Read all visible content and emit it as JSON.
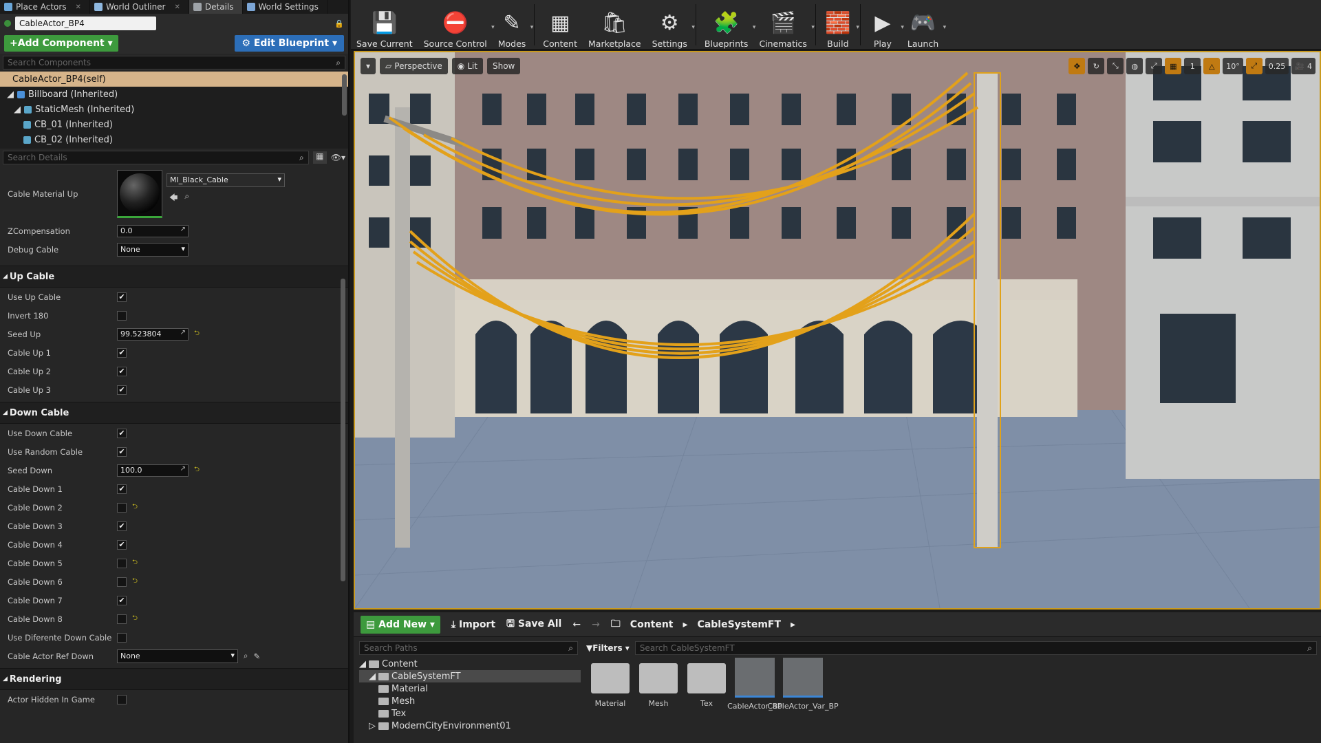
{
  "tabs": [
    {
      "label": "Place Actors",
      "icon": "place-actors-icon"
    },
    {
      "label": "World Outliner",
      "icon": "outliner-icon"
    },
    {
      "label": "Details",
      "icon": "details-icon"
    },
    {
      "label": "World Settings",
      "icon": "world-settings-icon"
    }
  ],
  "actor_name": "CableActor_BP4",
  "add_component_label": "Add Component",
  "edit_blueprint_label": "Edit Blueprint",
  "search_components_placeholder": "Search Components",
  "components": {
    "self": "CableActor_BP4(self)",
    "items": [
      {
        "label": "Billboard (Inherited)"
      },
      {
        "label": "StaticMesh (Inherited)"
      },
      {
        "label": "CB_01 (Inherited)"
      },
      {
        "label": "CB_02 (Inherited)"
      }
    ]
  },
  "search_details_placeholder": "Search Details",
  "props_top": {
    "material_label": "Cable Material Up",
    "material_value": "MI_Black_Cable",
    "zcomp_label": "ZCompensation",
    "zcomp_value": "0.0",
    "debug_label": "Debug Cable",
    "debug_value": "None"
  },
  "up_cable": {
    "title": "Up Cable",
    "rows": [
      {
        "label": "Use Up Cable",
        "type": "check",
        "checked": true
      },
      {
        "label": "Invert 180",
        "type": "check",
        "checked": false
      },
      {
        "label": "Seed Up",
        "type": "num",
        "value": "99.523804"
      },
      {
        "label": "Cable Up 1",
        "type": "check",
        "checked": true
      },
      {
        "label": "Cable Up 2",
        "type": "check",
        "checked": true
      },
      {
        "label": "Cable Up 3",
        "type": "check",
        "checked": true
      }
    ]
  },
  "down_cable": {
    "title": "Down Cable",
    "rows": [
      {
        "label": "Use Down Cable",
        "type": "check",
        "checked": true
      },
      {
        "label": "Use Random Cable",
        "type": "check",
        "checked": true
      },
      {
        "label": "Seed Down",
        "type": "num",
        "value": "100.0"
      },
      {
        "label": "Cable Down 1",
        "type": "check",
        "checked": true
      },
      {
        "label": "Cable Down 2",
        "type": "check",
        "checked": false
      },
      {
        "label": "Cable Down 3",
        "type": "check",
        "checked": true
      },
      {
        "label": "Cable Down 4",
        "type": "check",
        "checked": true
      },
      {
        "label": "Cable Down 5",
        "type": "check",
        "checked": false
      },
      {
        "label": "Cable Down 6",
        "type": "check",
        "checked": false
      },
      {
        "label": "Cable Down 7",
        "type": "check",
        "checked": true
      },
      {
        "label": "Cable Down 8",
        "type": "check",
        "checked": false
      },
      {
        "label": "Use Diferente Down Cable",
        "type": "check",
        "checked": false
      },
      {
        "label": "Cable Actor Ref Down",
        "type": "dropdown",
        "value": "None"
      }
    ]
  },
  "rendering": {
    "title": "Rendering",
    "rows": [
      {
        "label": "Actor Hidden In Game",
        "type": "check",
        "checked": false
      }
    ]
  },
  "toolbar": [
    {
      "label": "Save Current",
      "icon": "save-icon"
    },
    {
      "label": "Source Control",
      "icon": "source-control-icon"
    },
    {
      "label": "Modes",
      "icon": "modes-icon"
    },
    {
      "label": "Content",
      "icon": "content-icon"
    },
    {
      "label": "Marketplace",
      "icon": "marketplace-icon"
    },
    {
      "label": "Settings",
      "icon": "settings-icon"
    },
    {
      "label": "Blueprints",
      "icon": "blueprints-icon"
    },
    {
      "label": "Cinematics",
      "icon": "cinematics-icon"
    },
    {
      "label": "Build",
      "icon": "build-icon"
    },
    {
      "label": "Play",
      "icon": "play-icon"
    },
    {
      "label": "Launch",
      "icon": "launch-icon"
    }
  ],
  "viewport": {
    "perspective": "Perspective",
    "lit": "Lit",
    "show": "Show",
    "grid_size": "1",
    "rotation_snap": "10°",
    "scale_snap": "0.25",
    "camera_speed": "4"
  },
  "content_browser": {
    "add_new": "Add New",
    "import": "Import",
    "save_all": "Save All",
    "breadcrumb": [
      "Content",
      "CableSystemFT"
    ],
    "search_paths_placeholder": "Search Paths",
    "filters": "Filters",
    "search_assets_placeholder": "Search CableSystemFT",
    "tree": [
      {
        "label": "Content",
        "level": 0
      },
      {
        "label": "CableSystemFT",
        "level": 1,
        "selected": true
      },
      {
        "label": "Material",
        "level": 2
      },
      {
        "label": "Mesh",
        "level": 2
      },
      {
        "label": "Tex",
        "level": 2
      },
      {
        "label": "ModernCityEnvironment01",
        "level": 1
      }
    ],
    "assets": [
      {
        "label": "Material",
        "kind": "folder"
      },
      {
        "label": "Mesh",
        "kind": "folder"
      },
      {
        "label": "Tex",
        "kind": "folder"
      },
      {
        "label": "CableActor_BP",
        "kind": "blueprint"
      },
      {
        "label": "CableActor_Var_BP",
        "kind": "blueprint"
      }
    ]
  }
}
